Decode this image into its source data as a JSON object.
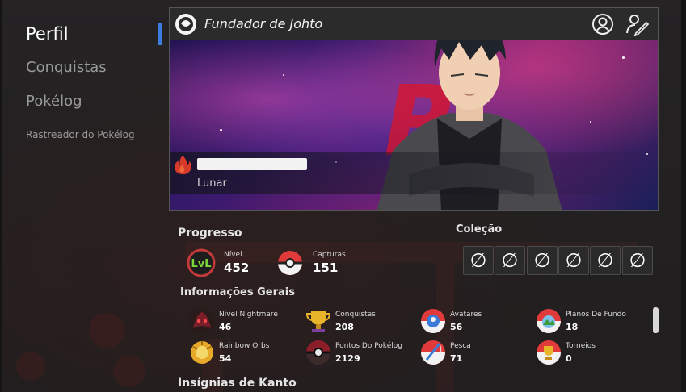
{
  "sidebar": {
    "items": [
      {
        "label": "Perfil",
        "active": true
      },
      {
        "label": "Conquistas"
      },
      {
        "label": "Pokélog"
      },
      {
        "label": "Rastreador do Pokélog"
      }
    ]
  },
  "banner": {
    "title": "Fundador de Johto",
    "username": "",
    "subtitle": "Lunar",
    "icons": [
      "trainer-logo-icon",
      "profile-icon",
      "edit-profile-icon",
      "fire-icon"
    ]
  },
  "progress": {
    "title": "Progresso",
    "stats": [
      {
        "label": "Nível",
        "value": "452",
        "icon": "level-icon"
      },
      {
        "label": "Capturas",
        "value": "151",
        "icon": "pokeball-icon"
      }
    ]
  },
  "collection": {
    "title": "Coleção",
    "slots": [
      "∅",
      "∅",
      "∅",
      "∅",
      "∅",
      "∅"
    ]
  },
  "info": {
    "title": "Informações Gerais",
    "items": [
      {
        "label": "Nível Nightmare",
        "value": "46",
        "icon": "nightmare-icon"
      },
      {
        "label": "Conquistas",
        "value": "208",
        "icon": "trophy-icon"
      },
      {
        "label": "Avatares",
        "value": "56",
        "icon": "avatar-icon"
      },
      {
        "label": "Planos De Fundo",
        "value": "18",
        "icon": "background-icon"
      },
      {
        "label": "Rainbow Orbs",
        "value": "54",
        "icon": "rainbow-orb-icon"
      },
      {
        "label": "Pontos Do Pokélog",
        "value": "2129",
        "icon": "pokelog-points-icon"
      },
      {
        "label": "Pesca",
        "value": "71",
        "icon": "fishing-icon"
      },
      {
        "label": "Torneios",
        "value": "0",
        "icon": "tournament-icon"
      }
    ]
  },
  "badges": {
    "title": "Insígnias de Kanto"
  },
  "colors": {
    "accent": "#3d7be0",
    "text": "#ffffff",
    "muted": "#9a9a9a"
  }
}
